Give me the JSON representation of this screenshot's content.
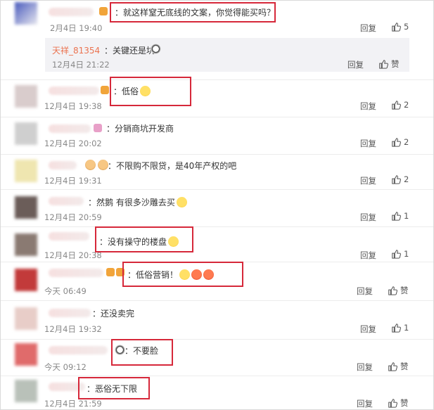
{
  "comments": [
    {
      "text": "：就这样窒无底线的文案，你觉得能买吗？",
      "time": "2月4日 19:40",
      "reply": "回复",
      "likes": "5",
      "nested": {
        "user": "天祥_81354",
        "text": "：关键还是坑",
        "time": "12月4日 21:22",
        "reply": "回复",
        "likes": "赞"
      }
    },
    {
      "text": "：低俗",
      "time": "12月4日 19:38",
      "reply": "回复",
      "likes": "2"
    },
    {
      "text": "：分销商坑开发商",
      "time": "12月4日 20:02",
      "reply": "回复",
      "likes": "2"
    },
    {
      "text": "：不限购不限贷，是40年产权的吧",
      "time": "12月4日 19:31",
      "reply": "回复",
      "likes": "2"
    },
    {
      "text": "：然鹅 有很多沙雕去买",
      "time": "12月4日 20:59",
      "reply": "回复",
      "likes": "1"
    },
    {
      "text": "：没有操守的楼盘",
      "time": "12月4日 20:38",
      "reply": "回复",
      "likes": "1"
    },
    {
      "text": "：低俗营销！",
      "time": "今天 06:49",
      "reply": "回复",
      "likes": "赞"
    },
    {
      "text": "：还没卖完",
      "time": "12月4日 19:32",
      "reply": "回复",
      "likes": "1"
    },
    {
      "text": "：不要脸",
      "time": "今天 09:12",
      "reply": "回复",
      "likes": "赞"
    },
    {
      "text": "：恶俗无下限",
      "time": "12月4日 21:59",
      "reply": "回复",
      "likes": "赞"
    }
  ],
  "icons": {
    "like": "thumb-up-icon",
    "emoji": "emoji-icon"
  },
  "colors": {
    "highlight_border": "#d6283a",
    "username": "#eb7350",
    "timestamp": "#888888"
  }
}
